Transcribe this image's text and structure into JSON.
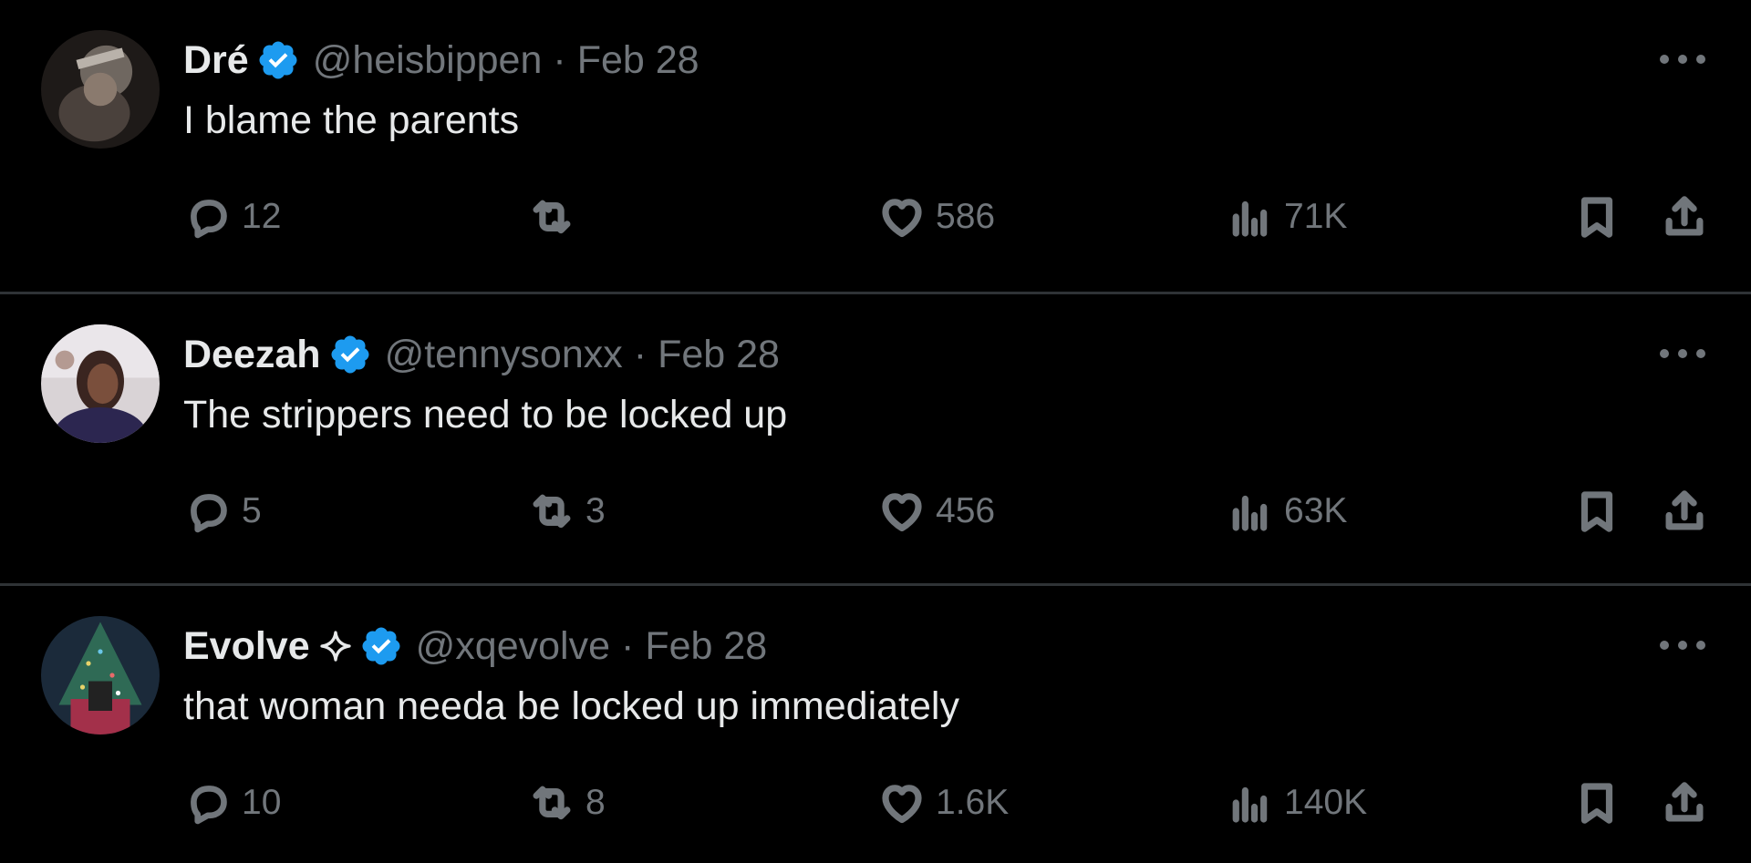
{
  "colors": {
    "background": "#000000",
    "text_primary": "#e7e9ea",
    "text_secondary": "#71767b",
    "verified_badge": "#1d9bf0",
    "divider": "#2f3336"
  },
  "tweets": [
    {
      "name": "Dré",
      "handle": "@heisbippen",
      "separator": "·",
      "date": "Feb 28",
      "text": "I blame the parents",
      "reply_count": "12",
      "retweet_count": "",
      "like_count": "586",
      "view_count": "71K"
    },
    {
      "name": "Deezah",
      "handle": "@tennysonxx",
      "separator": "·",
      "date": "Feb 28",
      "text": "The strippers need to be locked up",
      "reply_count": "5",
      "retweet_count": "3",
      "like_count": "456",
      "view_count": "63K"
    },
    {
      "name": "Evolve",
      "handle": "@xqevolve",
      "separator": "·",
      "date": "Feb 28",
      "text": "that woman needa be locked up immediately",
      "reply_count": "10",
      "retweet_count": "8",
      "like_count": "1.6K",
      "view_count": "140K"
    }
  ],
  "icons": {
    "reply": "reply-icon",
    "retweet": "retweet-icon",
    "like": "heart-icon",
    "views": "views-icon",
    "bookmark": "bookmark-icon",
    "share": "share-icon",
    "more": "more-icon",
    "verified": "verified-badge-icon",
    "sparkle": "sparkle-icon"
  }
}
